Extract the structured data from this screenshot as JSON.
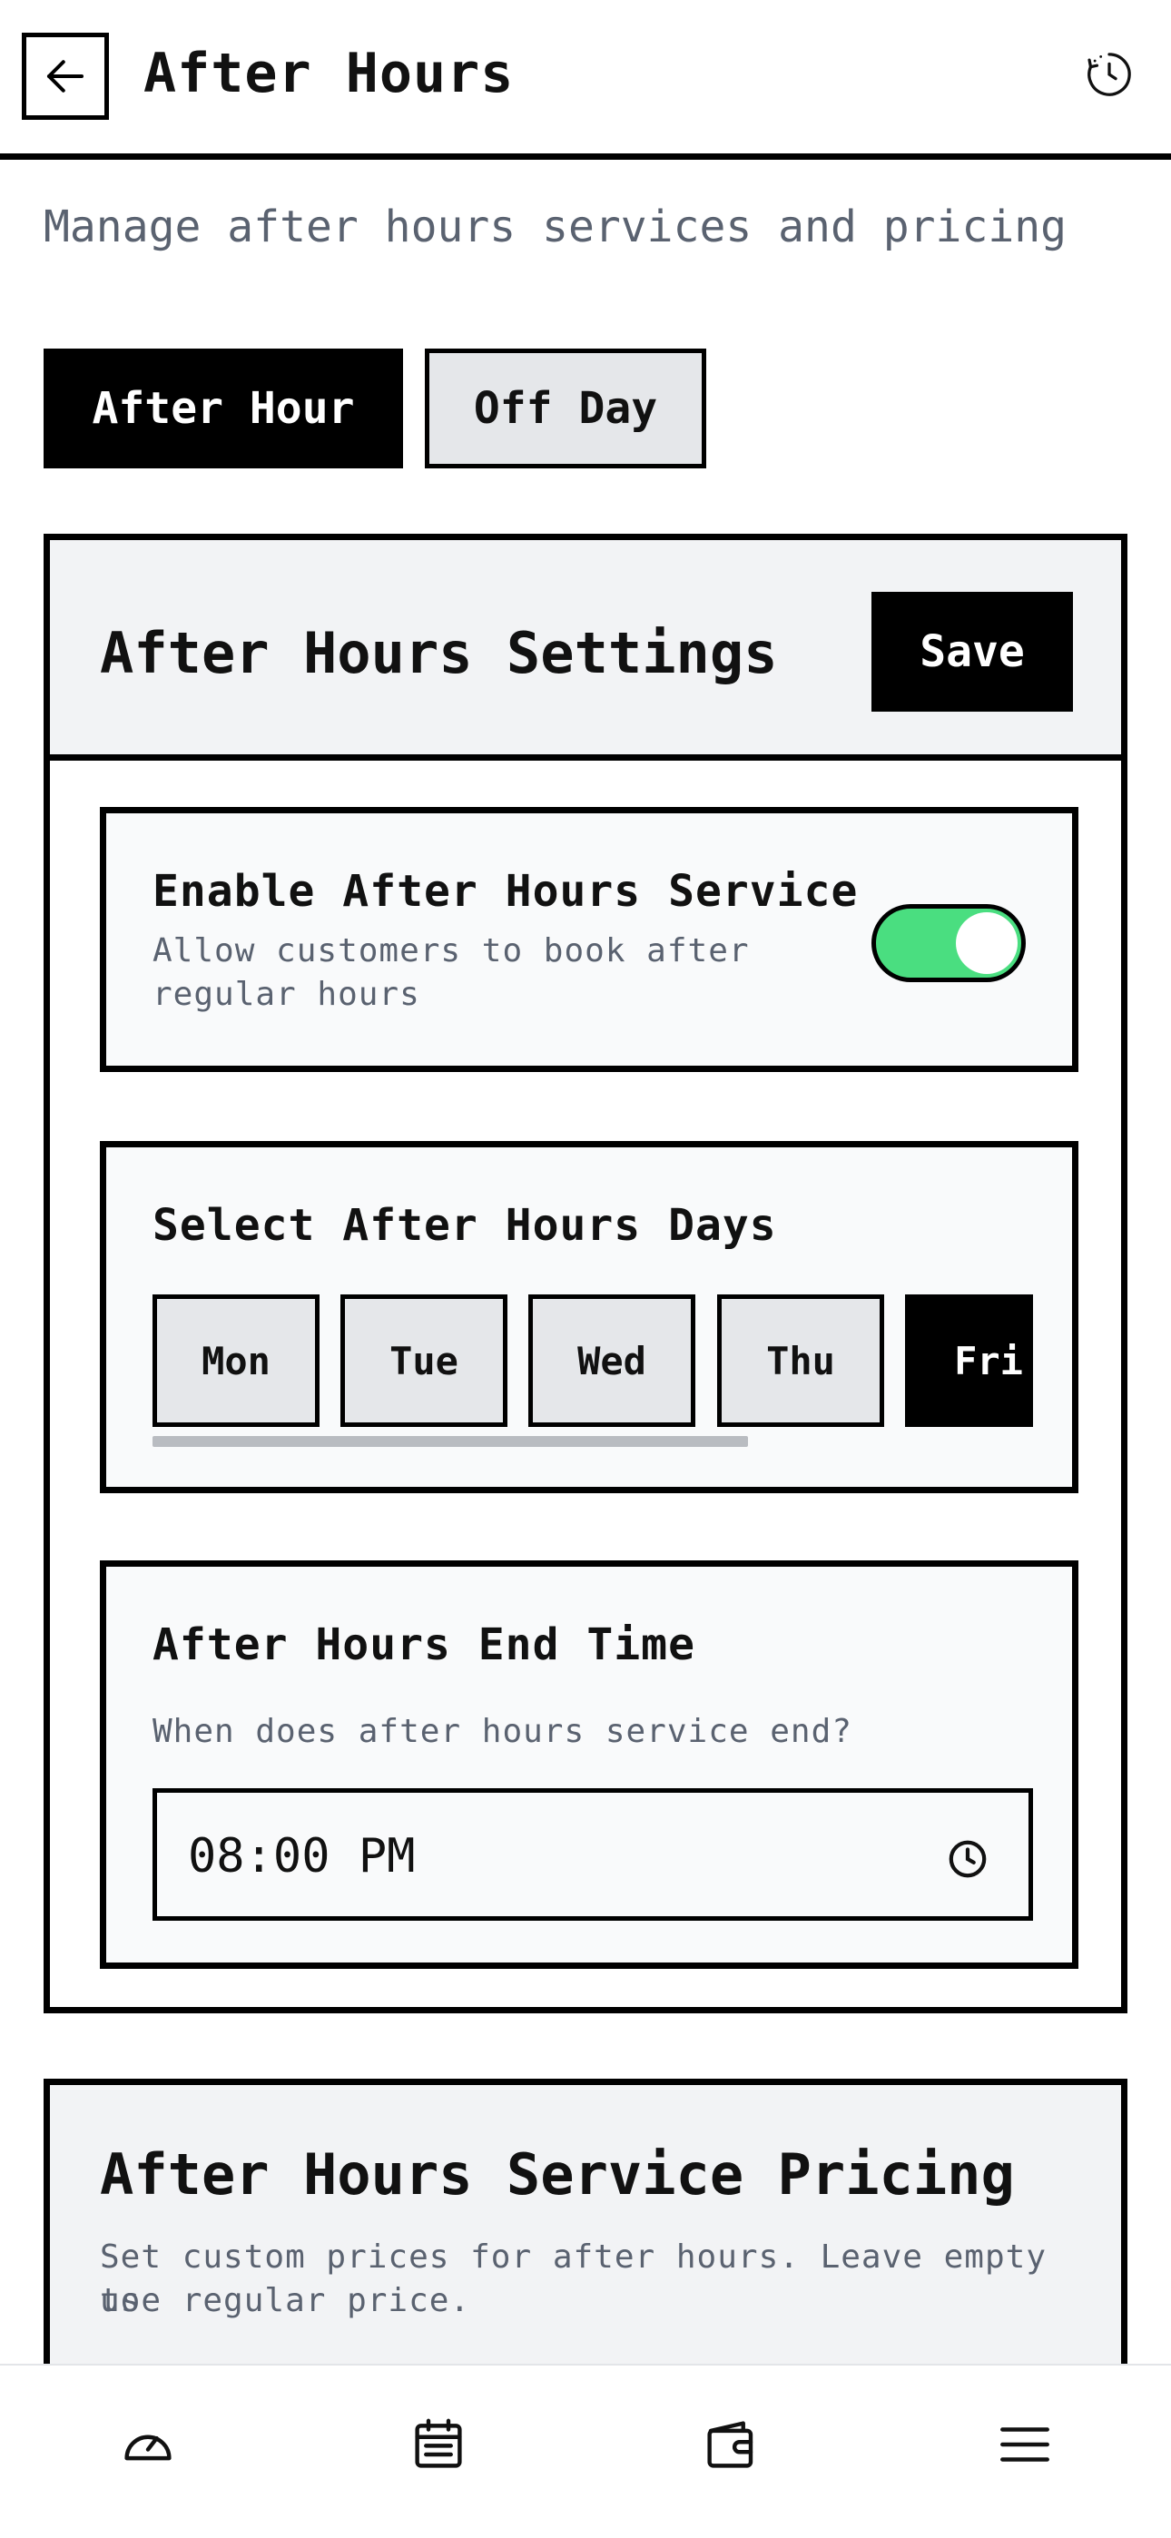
{
  "header": {
    "title": "After Hours",
    "back_icon": "arrow-left-icon",
    "history_icon": "history-icon"
  },
  "subtitle": "Manage after hours services and pricing",
  "tabs": [
    {
      "label": "After Hour",
      "active": true
    },
    {
      "label": "Off Day",
      "active": false
    }
  ],
  "settings": {
    "title": "After Hours Settings",
    "save_label": "Save",
    "enable": {
      "title": "Enable After Hours Service",
      "desc_line1": "Allow customers to book after",
      "desc_line2": "regular hours",
      "enabled": true
    },
    "days": {
      "title": "Select After Hours Days",
      "items": [
        {
          "label": "Mon",
          "selected": false
        },
        {
          "label": "Tue",
          "selected": false
        },
        {
          "label": "Wed",
          "selected": false
        },
        {
          "label": "Thu",
          "selected": false
        },
        {
          "label": "Fri",
          "selected": true
        }
      ]
    },
    "end_time": {
      "title": "After Hours End Time",
      "desc": "When does after hours service end?",
      "value": "08:00 PM"
    }
  },
  "pricing": {
    "title": "After Hours Service Pricing",
    "desc_line1": "Set custom prices for after hours. Leave empty to",
    "desc_line2": "use regular price."
  },
  "bottom_nav": [
    "dashboard-icon",
    "calendar-icon",
    "wallet-icon",
    "menu-icon"
  ],
  "colors": {
    "toggle_on": "#4ade80",
    "muted_text": "#5a6270",
    "chip_bg": "#e5e7ea",
    "card_head_bg": "#f2f3f5"
  }
}
